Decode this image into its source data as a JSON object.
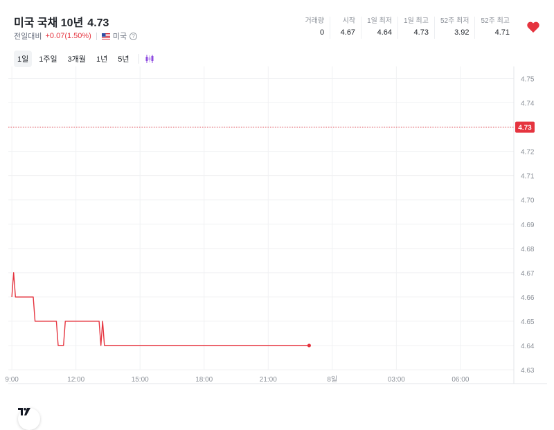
{
  "header": {
    "name": "미국 국채 10년",
    "price": "4.73",
    "change_label": "전일대비",
    "change_value": "+0.07(1.50%)",
    "country": "미국",
    "help": "?"
  },
  "stats": [
    {
      "label": "거래량",
      "value": "0"
    },
    {
      "label": "시작",
      "value": "4.67"
    },
    {
      "label": "1일 최저",
      "value": "4.64"
    },
    {
      "label": "1일 최고",
      "value": "4.73"
    },
    {
      "label": "52주 최저",
      "value": "3.92"
    },
    {
      "label": "52주 최고",
      "value": "4.71"
    }
  ],
  "periods": [
    "1일",
    "1주일",
    "3개월",
    "1년",
    "5년"
  ],
  "active_period": "1일",
  "colors": {
    "line": "#e5343f",
    "grid": "#f0f1f3",
    "axis_text": "#8b9098",
    "price_tag": "#e5343f",
    "heart": "#e5343f",
    "candle_icon": "#8f4de0"
  },
  "icons": [
    "heart-icon",
    "candlestick-icon",
    "us-flag-icon",
    "help-icon",
    "tradingview-logo-icon"
  ],
  "chart_data": {
    "type": "line",
    "title": "",
    "xlabel": "",
    "ylabel": "",
    "x_tick_labels": [
      {
        "x": 0,
        "label": "9:00"
      },
      {
        "x": 180,
        "label": "12:00"
      },
      {
        "x": 360,
        "label": "15:00"
      },
      {
        "x": 540,
        "label": "18:00"
      },
      {
        "x": 720,
        "label": "21:00"
      },
      {
        "x": 900,
        "label": "8일"
      },
      {
        "x": 1080,
        "label": "03:00"
      },
      {
        "x": 1260,
        "label": "06:00"
      }
    ],
    "x_unit": "minutes since 9:00",
    "xlim": [
      -10,
      1410
    ],
    "ylim": [
      4.63,
      4.755
    ],
    "y_ticks": [
      4.63,
      4.64,
      4.65,
      4.66,
      4.67,
      4.68,
      4.69,
      4.7,
      4.71,
      4.72,
      4.73,
      4.74,
      4.75
    ],
    "y_tick_labels": [
      "4.63",
      "4.64",
      "4.65",
      "4.66",
      "4.67",
      "4.68",
      "4.69",
      "4.70",
      "4.71",
      "4.72",
      "4.73",
      "4.74",
      "4.75"
    ],
    "current_value": 4.73,
    "current_label": "4.73",
    "grid": true,
    "series": [
      {
        "x": [
          0,
          5,
          10,
          60,
          65,
          125,
          130,
          145,
          150,
          245,
          250,
          255,
          260,
          265,
          295,
          300,
          305,
          310,
          315,
          320,
          325,
          335,
          340,
          355,
          360,
          365,
          370,
          375,
          380,
          385,
          390,
          395,
          400,
          405,
          410,
          415,
          455,
          460,
          465,
          470,
          475,
          480,
          485,
          490,
          495,
          500,
          505,
          510,
          515,
          520,
          525,
          530,
          535,
          540,
          545,
          550,
          555,
          560,
          565,
          570,
          575,
          580,
          585,
          590,
          595,
          600,
          605,
          610,
          615,
          620,
          625,
          630,
          635,
          640,
          645,
          650,
          655,
          660,
          665,
          670,
          675,
          680,
          685,
          690,
          695,
          700,
          705,
          710,
          715,
          720,
          725,
          730,
          735,
          740,
          745,
          750,
          755,
          760,
          765,
          770,
          775,
          780,
          785,
          790,
          795,
          800,
          805,
          810,
          815,
          820,
          825,
          830,
          835
        ],
        "y": [
          4.66,
          4.67,
          4.66,
          4.66,
          4.65,
          4.65,
          4.64,
          4.64,
          4.65,
          4.65,
          4.64,
          4.65,
          4.64,
          4.64,
          4.64,
          4.64,
          4.64,
          4.64,
          4.64,
          4.64,
          4.64,
          4.64,
          4.64,
          4.64,
          4.64,
          4.64,
          4.64,
          4.64,
          4.64,
          4.64,
          4.64,
          4.64,
          4.64,
          4.64,
          4.64,
          4.64,
          4.64,
          4.64,
          4.64,
          4.64,
          4.64,
          4.64,
          4.64,
          4.64,
          4.64,
          4.64,
          4.64,
          4.64,
          4.64,
          4.64,
          4.64,
          4.64,
          4.64,
          4.64,
          4.64,
          4.64,
          4.64,
          4.64,
          4.64,
          4.64,
          4.64,
          4.64,
          4.64,
          4.64,
          4.64,
          4.64,
          4.64,
          4.64,
          4.64,
          4.64,
          4.64,
          4.64,
          4.64,
          4.64,
          4.64,
          4.64,
          4.64,
          4.64,
          4.64,
          4.64,
          4.64,
          4.64,
          4.64,
          4.64,
          4.64,
          4.64,
          4.64,
          4.64,
          4.64,
          4.64,
          4.64,
          4.64,
          4.64,
          4.64,
          4.64,
          4.64,
          4.64,
          4.64,
          4.64,
          4.64,
          4.64,
          4.64,
          4.64,
          4.64,
          4.64,
          4.64,
          4.64,
          4.64,
          4.64,
          4.64,
          4.64,
          4.64,
          4.64
        ]
      }
    ]
  }
}
